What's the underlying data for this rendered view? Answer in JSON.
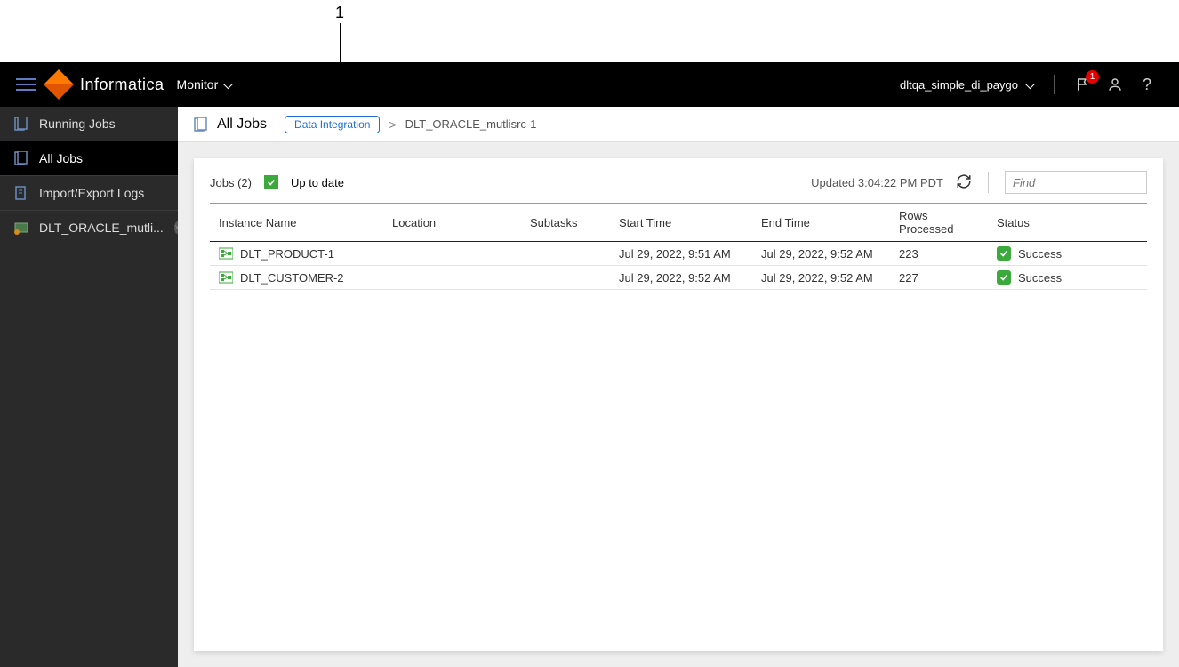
{
  "annotation": {
    "label": "1"
  },
  "header": {
    "brand": "Informatica",
    "product": "Monitor",
    "org": "dltqa_simple_di_paygo",
    "notification_count": "1"
  },
  "sidebar": {
    "items": [
      {
        "label": "Running Jobs",
        "icon": "jobs-icon",
        "active": false
      },
      {
        "label": "All Jobs",
        "icon": "jobs-icon",
        "active": true
      },
      {
        "label": "Import/Export Logs",
        "icon": "logs-icon",
        "active": false
      },
      {
        "label": "DLT_ORACLE_mutli...",
        "icon": "task-icon",
        "active": false,
        "closable": true
      }
    ]
  },
  "breadcrumb": {
    "title": "All Jobs",
    "chip": "Data Integration",
    "current": "DLT_ORACLE_mutlisrc-1"
  },
  "panel": {
    "jobs_label": "Jobs (2)",
    "uptodate_label": "Up to date",
    "updated_label": "Updated 3:04:22 PM PDT",
    "find_placeholder": "Find"
  },
  "table": {
    "columns": [
      "Instance Name",
      "Location",
      "Subtasks",
      "Start Time",
      "End Time",
      "Rows Processed",
      "Status"
    ],
    "rows": [
      {
        "instance": "DLT_PRODUCT-1",
        "location": "",
        "subtasks": "",
        "start": "Jul 29, 2022, 9:51 AM",
        "end": "Jul 29, 2022, 9:52 AM",
        "rows": "223",
        "status": "Success"
      },
      {
        "instance": "DLT_CUSTOMER-2",
        "location": "",
        "subtasks": "",
        "start": "Jul 29, 2022, 9:52 AM",
        "end": "Jul 29, 2022, 9:52 AM",
        "rows": "227",
        "status": "Success"
      }
    ]
  }
}
